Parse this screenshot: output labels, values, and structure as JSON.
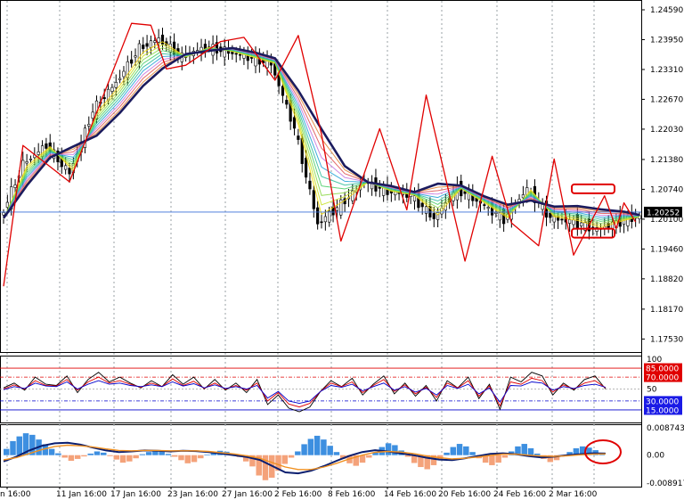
{
  "chart_data": [
    {
      "type": "line",
      "panel": "price",
      "title": "",
      "y_ticks": [
        "1.24590",
        "1.23950",
        "1.23310",
        "1.22670",
        "1.22030",
        "1.21380",
        "1.20740",
        "1.20100",
        "1.19460",
        "1.18820",
        "1.18170",
        "1.17530"
      ],
      "ylim": [
        1.1725,
        1.248
      ],
      "current_price": 1.20252,
      "current_price_label": "1.20252",
      "series": [
        {
          "name": "",
          "kind": "slow_ma",
          "color": "#1b1b5e",
          "points": [
            [
              0,
              1.2012
            ],
            [
              6,
              1.2082
            ],
            [
              12,
              1.2142
            ],
            [
              18,
              1.2166
            ],
            [
              24,
              1.2189
            ],
            [
              30,
              1.2238
            ],
            [
              36,
              1.2296
            ],
            [
              41,
              1.2333
            ],
            [
              47,
              1.2364
            ],
            [
              53,
              1.2371
            ],
            [
              59,
              1.2377
            ],
            [
              65,
              1.2367
            ],
            [
              70,
              1.2355
            ],
            [
              76,
              1.2286
            ],
            [
              82,
              1.2203
            ],
            [
              88,
              1.2124
            ],
            [
              94,
              1.2089
            ],
            [
              100,
              1.2081
            ],
            [
              106,
              1.2068
            ],
            [
              112,
              1.2086
            ],
            [
              118,
              1.2082
            ],
            [
              124,
              1.2059
            ],
            [
              130,
              1.2041
            ],
            [
              136,
              1.205
            ],
            [
              142,
              1.2037
            ],
            [
              148,
              1.2038
            ],
            [
              154,
              1.2031
            ],
            [
              160,
              1.2026
            ],
            [
              164,
              1.2019
            ]
          ]
        },
        {
          "name": "",
          "kind": "fast_ma",
          "color": "#e6b800",
          "points": [
            [
              0,
              1.201
            ],
            [
              6,
              1.2128
            ],
            [
              12,
              1.2168
            ],
            [
              18,
              1.2108
            ],
            [
              24,
              1.2243
            ],
            [
              30,
              1.2303
            ],
            [
              36,
              1.2376
            ],
            [
              41,
              1.2397
            ],
            [
              47,
              1.2357
            ],
            [
              53,
              1.2379
            ],
            [
              59,
              1.2369
            ],
            [
              65,
              1.2355
            ],
            [
              70,
              1.2343
            ],
            [
              76,
              1.2205
            ],
            [
              82,
              1.2
            ],
            [
              88,
              1.2042
            ],
            [
              94,
              1.209
            ],
            [
              100,
              1.2069
            ],
            [
              106,
              1.2061
            ],
            [
              112,
              1.2012
            ],
            [
              118,
              1.2075
            ],
            [
              124,
              1.2044
            ],
            [
              130,
              1.201
            ],
            [
              136,
              1.2075
            ],
            [
              142,
              1.2013
            ],
            [
              148,
              1.2004
            ],
            [
              154,
              1.1988
            ],
            [
              160,
              1.2005
            ],
            [
              164,
              1.2015
            ]
          ]
        },
        {
          "name": "",
          "kind": "zigzag",
          "color": "#e00000",
          "points": [
            [
              0,
              1.1866
            ],
            [
              5,
              1.2168
            ],
            [
              17,
              1.209
            ],
            [
              33,
              1.243
            ],
            [
              38,
              1.2426
            ],
            [
              42,
              1.2332
            ],
            [
              47,
              1.234
            ],
            [
              56,
              1.2391
            ],
            [
              62,
              1.24
            ],
            [
              70,
              1.2308
            ],
            [
              76,
              1.2404
            ],
            [
              82,
              1.2192
            ],
            [
              87,
              1.1963
            ],
            [
              97,
              1.2204
            ],
            [
              104,
              1.203
            ],
            [
              109,
              1.2276
            ],
            [
              119,
              1.192
            ],
            [
              126,
              1.2145
            ],
            [
              131,
              1.2002
            ],
            [
              138,
              1.1953
            ],
            [
              142,
              1.2139
            ],
            [
              147,
              1.1933
            ],
            [
              155,
              1.206
            ],
            [
              158,
              1.199
            ],
            [
              160,
              1.2045
            ],
            [
              163,
              1.2004
            ]
          ]
        }
      ],
      "annotations": [
        {
          "shape": "rounded-rectangle",
          "color": "#e00000",
          "y": 1.2075
        },
        {
          "shape": "rounded-rectangle",
          "color": "#e00000",
          "y": 1.198
        }
      ]
    },
    {
      "type": "line",
      "panel": "oscillator",
      "title": "",
      "ylim": [
        0,
        100
      ],
      "y_ticks": [
        "100",
        "50"
      ],
      "levels": [
        {
          "value": 85,
          "label": "85.0000",
          "color": "#e00000",
          "badge": "#e00000"
        },
        {
          "value": 70,
          "label": "70.0000",
          "color": "#e00000",
          "badge": "#e00000"
        },
        {
          "value": 30,
          "label": "30.0000",
          "color": "#0000cc",
          "badge": "#1a1ae6"
        },
        {
          "value": 15,
          "label": "15.0000",
          "color": "#0000cc",
          "badge": "#1a1ae6"
        }
      ],
      "series": [
        {
          "name": "",
          "color": "#000000",
          "values": [
            52,
            60,
            48,
            70,
            58,
            56,
            72,
            44,
            66,
            78,
            62,
            70,
            60,
            52,
            64,
            54,
            74,
            58,
            70,
            50,
            66,
            48,
            60,
            44,
            66,
            24,
            40,
            18,
            12,
            20,
            46,
            64,
            54,
            68,
            40,
            58,
            72,
            42,
            60,
            38,
            56,
            30,
            64,
            52,
            70,
            34,
            58,
            16,
            70,
            62,
            78,
            72,
            40,
            60,
            48,
            66,
            72,
            50
          ]
        },
        {
          "name": "",
          "color": "#e00000",
          "values": [
            50,
            57,
            50,
            64,
            56,
            55,
            66,
            48,
            62,
            70,
            60,
            64,
            58,
            53,
            60,
            54,
            67,
            56,
            63,
            51,
            60,
            50,
            56,
            48,
            60,
            30,
            44,
            25,
            20,
            26,
            46,
            60,
            54,
            62,
            44,
            56,
            66,
            46,
            57,
            42,
            53,
            36,
            60,
            52,
            64,
            38,
            55,
            22,
            62,
            58,
            68,
            64,
            45,
            57,
            50,
            60,
            64,
            52
          ]
        },
        {
          "name": "",
          "color": "#0000cc",
          "values": [
            49,
            54,
            51,
            60,
            55,
            54,
            62,
            50,
            58,
            64,
            58,
            60,
            56,
            54,
            57,
            54,
            62,
            55,
            59,
            52,
            57,
            51,
            54,
            50,
            56,
            35,
            46,
            30,
            26,
            30,
            46,
            56,
            53,
            58,
            47,
            54,
            60,
            48,
            54,
            45,
            51,
            40,
            56,
            51,
            58,
            42,
            52,
            28,
            56,
            55,
            62,
            60,
            48,
            54,
            51,
            56,
            58,
            53
          ]
        }
      ]
    },
    {
      "type": "bar",
      "panel": "histogram",
      "title": "",
      "ylim": [
        -0.0089178,
        0.0087434
      ],
      "y_ticks": [
        "0.0087434",
        "0.00",
        "-0.0089178"
      ],
      "bar_colors": {
        "positive": "#3d8fe0",
        "negative": "#f4a27a"
      },
      "bars": [
        2.0,
        4.5,
        6.0,
        7.0,
        6.5,
        5.0,
        3.5,
        2.0,
        0.6,
        -0.8,
        -1.8,
        -1.2,
        -0.4,
        0.5,
        1.2,
        0.8,
        -0.3,
        -1.4,
        -2.4,
        -2.0,
        -1.0,
        0.3,
        1.0,
        1.6,
        1.2,
        0.4,
        -0.5,
        -1.6,
        -2.6,
        -2.2,
        -1.0,
        0.2,
        0.9,
        1.4,
        1.1,
        0.4,
        -0.6,
        -2.0,
        -3.6,
        -6.5,
        -8.0,
        -7.2,
        -5.0,
        -2.8,
        -0.8,
        1.2,
        3.5,
        5.2,
        6.2,
        5.0,
        3.0,
        1.0,
        -1.2,
        -2.6,
        -3.4,
        -2.4,
        -0.8,
        0.8,
        2.6,
        3.8,
        3.2,
        1.5,
        -0.5,
        -2.5,
        -3.8,
        -4.5,
        -3.2,
        -1.4,
        0.8,
        2.6,
        3.6,
        2.8,
        1.0,
        -1.0,
        -2.4,
        -3.2,
        -2.4,
        -0.8,
        1.2,
        2.8,
        3.6,
        2.2,
        0.5,
        -1.2,
        -2.2,
        -1.6,
        -0.4,
        1.0,
        2.2,
        2.8,
        2.4,
        1.6,
        0.8
      ],
      "series": [
        {
          "name": "",
          "color": "#0b1e6f",
          "values": [
            -2.0,
            -0.5,
            1.5,
            3.0,
            3.8,
            4.0,
            3.4,
            2.4,
            1.5,
            1.0,
            1.2,
            1.5,
            1.4,
            1.2,
            1.4,
            1.3,
            1.0,
            0.5,
            0.0,
            -0.6,
            -1.5,
            -3.5,
            -5.5,
            -5.8,
            -5.0,
            -3.5,
            -1.8,
            -0.2,
            1.0,
            1.6,
            1.2,
            0.6,
            0.0,
            -0.8,
            -1.4,
            -1.6,
            -1.0,
            -0.3,
            0.4,
            0.6,
            0.3,
            -0.3,
            -0.7,
            -0.5,
            0.0,
            0.3,
            0.6,
            0.5
          ]
        },
        {
          "name": "",
          "color": "#f09020",
          "values": [
            -1.5,
            -0.8,
            0.5,
            1.8,
            2.8,
            3.2,
            3.0,
            2.6,
            2.0,
            1.5,
            1.4,
            1.5,
            1.5,
            1.4,
            1.4,
            1.4,
            1.2,
            0.8,
            0.4,
            -0.2,
            -1.0,
            -2.4,
            -3.8,
            -4.6,
            -4.6,
            -3.8,
            -2.6,
            -1.2,
            0.0,
            0.9,
            1.2,
            1.0,
            0.5,
            -0.2,
            -0.8,
            -1.2,
            -1.0,
            -0.6,
            -0.1,
            0.3,
            0.3,
            0.0,
            -0.3,
            -0.4,
            -0.2,
            0.1,
            0.3,
            0.4
          ]
        }
      ],
      "annotations": [
        {
          "shape": "ellipse",
          "color": "#e00000"
        }
      ]
    }
  ],
  "x_axis": {
    "tick_labels": [
      "n 16:00",
      "11 Jan 16:00",
      "17 Jan 16:00",
      "23 Jan 16:00",
      "27 Jan 16:00",
      "2 Feb 16:00",
      "8 Feb 16:00",
      "14 Feb 16:00",
      "20 Feb 16:00",
      "24 Feb 16:00",
      "2 Mar 16:00"
    ]
  }
}
